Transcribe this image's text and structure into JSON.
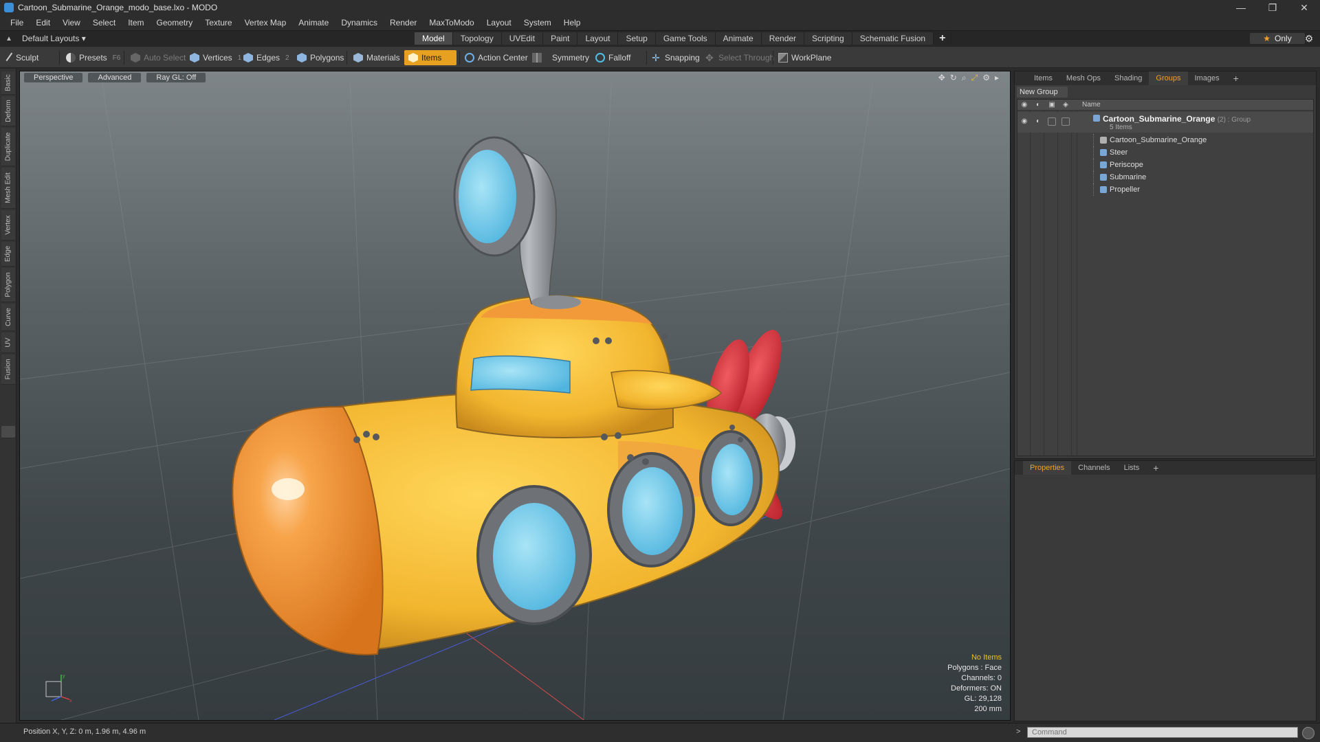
{
  "window": {
    "title": "Cartoon_Submarine_Orange_modo_base.lxo - MODO",
    "controls": [
      "—",
      "❐",
      "✕"
    ]
  },
  "menu": [
    "File",
    "Edit",
    "View",
    "Select",
    "Item",
    "Geometry",
    "Texture",
    "Vertex Map",
    "Animate",
    "Dynamics",
    "Render",
    "MaxToModo",
    "Layout",
    "System",
    "Help"
  ],
  "layout": {
    "selector": "Default Layouts ▾",
    "tabs": [
      "Model",
      "Topology",
      "UVEdit",
      "Paint",
      "Layout",
      "Setup",
      "Game Tools",
      "Animate",
      "Render",
      "Scripting",
      "Schematic Fusion"
    ],
    "active_tab": "Model",
    "only_label": "Only"
  },
  "toolbar": {
    "sculpt": "Sculpt",
    "presets": "Presets",
    "presets_key": "F6",
    "auto_select": "Auto Select",
    "vertices": "Vertices",
    "vertices_key": "1",
    "edges": "Edges",
    "edges_key": "2",
    "polygons": "Polygons",
    "materials": "Materials",
    "items": "Items",
    "action_center": "Action Center",
    "symmetry": "Symmetry",
    "falloff": "Falloff",
    "snapping": "Snapping",
    "select_through": "Select Through",
    "workplane": "WorkPlane"
  },
  "left_tabs": [
    "Basic",
    "Deform",
    "Duplicate",
    "Mesh Edit",
    "Vertex",
    "Edge",
    "Polygon",
    "Curve",
    "UV",
    "Fusion"
  ],
  "viewport": {
    "view_mode": "Perspective",
    "shading": "Advanced",
    "raygl": "Ray GL: Off",
    "info": {
      "items": "No Items",
      "polygons": "Polygons : Face",
      "channels": "Channels: 0",
      "deformers": "Deformers: ON",
      "gl": "GL: 29,128",
      "scale": "200 mm"
    },
    "axis_labels": {
      "x": "x",
      "y": "y"
    }
  },
  "groups_panel": {
    "tabs": [
      "Items",
      "Mesh Ops",
      "Shading",
      "Groups",
      "Images"
    ],
    "active_tab": "Groups",
    "new_group": "New Group",
    "column_name": "Name",
    "root": {
      "name": "Cartoon_Submarine_Orange",
      "suffix": "(2) : Group",
      "count": "5 Items"
    },
    "items": [
      "Cartoon_Submarine_Orange",
      "Steer",
      "Periscope",
      "Submarine",
      "Propeller"
    ]
  },
  "properties_panel": {
    "tabs": [
      "Properties",
      "Channels",
      "Lists"
    ],
    "active_tab": "Properties"
  },
  "status": {
    "position": "Position X, Y, Z:  0 m, 1.96 m, 4.96 m",
    "command_placeholder": "Command"
  },
  "colors": {
    "accent": "#e8a020",
    "panel_bg": "#3a3a3a",
    "submarine_yellow": "#f5c23a",
    "submarine_orange": "#f2972e",
    "window_blue": "#6cc4e6",
    "propeller_red": "#d8343c"
  }
}
